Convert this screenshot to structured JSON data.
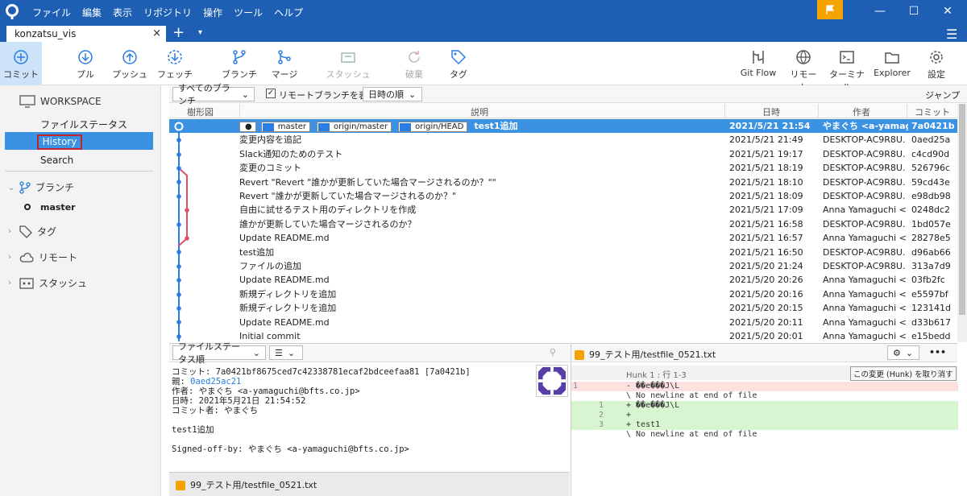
{
  "titlebar": {
    "menu": [
      "ファイル",
      "編集",
      "表示",
      "リポジトリ",
      "操作",
      "ツール",
      "ヘルプ"
    ]
  },
  "tab": {
    "label": "konzatsu_vis",
    "close": "×",
    "add": "+",
    "dropdown": "▾"
  },
  "toolbar": {
    "commit": "コミット",
    "pull": "プル",
    "push": "プッシュ",
    "fetch": "フェッチ",
    "branch": "ブランチ",
    "merge": "マージ",
    "stash": "スタッシュ",
    "discard": "破棄",
    "tag": "タグ",
    "gitflow": "Git Flow",
    "remote": "リモート",
    "terminal": "ターミナル",
    "explorer": "Explorer",
    "settings": "設定"
  },
  "sidebar": {
    "workspace": "WORKSPACE",
    "file_status": "ファイルステータス",
    "history": "History",
    "search": "Search",
    "branches": "ブランチ",
    "master": "master",
    "tags": "タグ",
    "remotes": "リモート",
    "stashes": "スタッシュ"
  },
  "filterbar": {
    "branch_filter": "すべてのブランチ",
    "show_remote": "リモートブランチを表示",
    "sort": "日時の順",
    "jump": "ジャンプ先:"
  },
  "log_columns": {
    "graph": "樹形図",
    "desc": "説明",
    "date": "日時",
    "author": "作者",
    "commit": "コミット"
  },
  "refs": [
    "master",
    "origin/master",
    "origin/HEAD"
  ],
  "commits": [
    {
      "msg": "test1追加",
      "date": "2021/5/21 21:54",
      "author": "やまぐち <a-yamagu",
      "hash": "7a0421b"
    },
    {
      "msg": "変更内容を追記",
      "date": "2021/5/21 21:49",
      "author": "DESKTOP-AC9R8U.",
      "hash": "0aed25a"
    },
    {
      "msg": "Slack通知のためのテスト",
      "date": "2021/5/21 19:17",
      "author": "DESKTOP-AC9R8U.",
      "hash": "c4cd90d"
    },
    {
      "msg": "変更のコミット",
      "date": "2021/5/21 18:19",
      "author": "DESKTOP-AC9R8U.",
      "hash": "526796c"
    },
    {
      "msg": "Revert \"Revert \"誰かが更新していた場合マージされるのか？\"\"",
      "date": "2021/5/21 18:10",
      "author": "DESKTOP-AC9R8U.",
      "hash": "59cd43e"
    },
    {
      "msg": "Revert \"誰かが更新していた場合マージされるのか？\"",
      "date": "2021/5/21 18:09",
      "author": "DESKTOP-AC9R8U.",
      "hash": "e98db98"
    },
    {
      "msg": "自由に試せるテスト用のディレクトリを作成",
      "date": "2021/5/21 17:09",
      "author": "Anna Yamaguchi <",
      "hash": "0248dc2"
    },
    {
      "msg": "誰かが更新していた場合マージされるのか？",
      "date": "2021/5/21 16:58",
      "author": "DESKTOP-AC9R8U.",
      "hash": "1bd057e"
    },
    {
      "msg": "Update README.md",
      "date": "2021/5/21 16:57",
      "author": "Anna Yamaguchi <",
      "hash": "28278e5"
    },
    {
      "msg": "test追加",
      "date": "2021/5/21 16:50",
      "author": "DESKTOP-AC9R8U.",
      "hash": "d96ab66"
    },
    {
      "msg": "ファイルの追加",
      "date": "2021/5/20 21:24",
      "author": "DESKTOP-AC9R8U.",
      "hash": "313a7d9"
    },
    {
      "msg": "Update README.md",
      "date": "2021/5/20 20:26",
      "author": "Anna Yamaguchi <",
      "hash": "03fb2fc"
    },
    {
      "msg": "新規ディレクトリを追加",
      "date": "2021/5/20 20:16",
      "author": "Anna Yamaguchi <",
      "hash": "e5597bf"
    },
    {
      "msg": "新規ディレクトリを追加",
      "date": "2021/5/20 20:15",
      "author": "Anna Yamaguchi <",
      "hash": "123141d"
    },
    {
      "msg": "Update README.md",
      "date": "2021/5/20 20:11",
      "author": "Anna Yamaguchi <",
      "hash": "d33b617"
    },
    {
      "msg": "Initial commit",
      "date": "2021/5/20 20:01",
      "author": "Anna Yamaguchi <",
      "hash": "e15bedd"
    }
  ],
  "details": {
    "sort": "ファイルステータス順",
    "commit": "コミット: 7a0421bf8675ced7c42338781ecaf2bdceefaa81 [7a0421b]",
    "parent_label": "親: ",
    "parent": "0aed25ac21",
    "author": "作者: やまぐち <a-yamaguchi@bfts.co.jp>",
    "date": "日時: 2021年5月21日 21:54:52",
    "committer": "コミット者: やまぐち",
    "message": "test1追加",
    "signoff": "Signed-off-by: やまぐち <a-yamaguchi@bfts.co.jp>",
    "file": "99_テスト用/testfile_0521.txt"
  },
  "diff": {
    "file": "99_テスト用/testfile_0521.txt",
    "hunk": "Hunk 1 : 行 1-3",
    "discard_hunk": "この変更 (Hunk) を取り消す",
    "more": "•••",
    "lines": [
      {
        "old": "1",
        "new": "",
        "text": "- ��e���J\\L",
        "type": "del"
      },
      {
        "old": "",
        "new": "",
        "text": "\\ No newline at end of file",
        "type": "ctx"
      },
      {
        "old": "",
        "new": "1",
        "text": "+ ��e���J\\L",
        "type": "add"
      },
      {
        "old": "",
        "new": "2",
        "text": "+",
        "type": "add"
      },
      {
        "old": "",
        "new": "3",
        "text": "+ test1",
        "type": "add"
      },
      {
        "old": "",
        "new": "",
        "text": "\\ No newline at end of file",
        "type": "ctx"
      }
    ]
  },
  "colors": {
    "accent": "#1e5fb4",
    "selection": "#3b92e3",
    "graph_main": "#2a7de1",
    "graph_branch": "#e0506a",
    "add_bg": "#d6f5d0",
    "del_bg": "#fde0e0"
  }
}
